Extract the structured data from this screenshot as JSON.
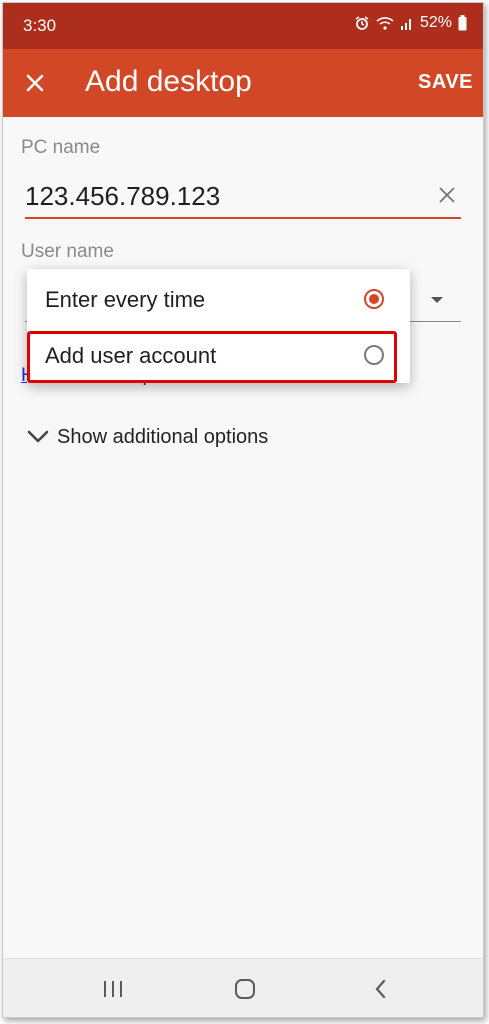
{
  "status_bar": {
    "time": "3:30",
    "battery_percent": "52%",
    "icons": [
      "alarm-icon",
      "wifi-icon",
      "signal-icon",
      "battery-icon"
    ]
  },
  "app_bar": {
    "title": "Add desktop",
    "save_label": "SAVE",
    "close_icon": "close-icon",
    "color": "#d24726"
  },
  "form": {
    "pc_name_label": "PC name",
    "pc_name_value": "123.456.789.123",
    "user_name_label": "User name",
    "help_link": "How do I set up a PC?"
  },
  "user_dropdown": {
    "options": [
      {
        "label": "Enter every time",
        "selected": true
      },
      {
        "label": "Add user account",
        "selected": false
      }
    ],
    "highlighted_option": "Add user account"
  },
  "more_options": {
    "label": "Show additional options",
    "icon": "chevron-down-icon"
  },
  "nav_bar": {
    "icons": [
      "recent-apps-icon",
      "home-icon",
      "back-icon"
    ]
  },
  "colors": {
    "status_bar": "#ad2e1c",
    "accent": "#d24726",
    "highlight": "#e00000",
    "link": "#1a2fd6"
  }
}
